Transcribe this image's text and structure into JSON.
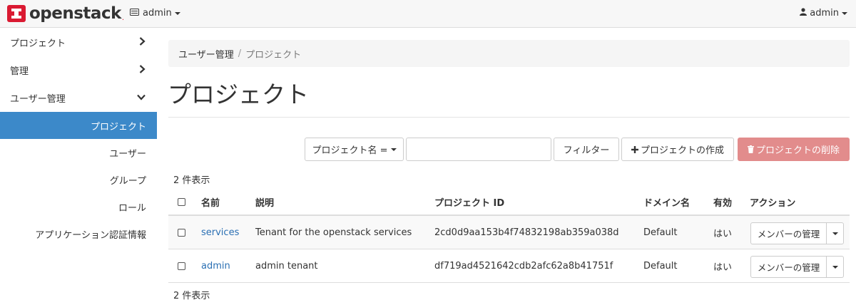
{
  "navbar": {
    "brand": "openstack",
    "brand_mark": ".",
    "project_switcher": "admin",
    "user_menu": "admin"
  },
  "sidebar": {
    "groups": [
      {
        "label": "プロジェクト",
        "icon": "chevron-right-icon"
      },
      {
        "label": "管理",
        "icon": "chevron-right-icon"
      },
      {
        "label": "ユーザー管理",
        "icon": "chevron-down-icon"
      }
    ],
    "sub_items": [
      {
        "label": "プロジェクト",
        "active": true
      },
      {
        "label": "ユーザー"
      },
      {
        "label": "グループ"
      },
      {
        "label": "ロール"
      },
      {
        "label": "アプリケーション認証情報"
      }
    ]
  },
  "breadcrumb": {
    "parent": "ユーザー管理",
    "separator": "/",
    "current": "プロジェクト"
  },
  "page_title": "プロジェクト",
  "toolbar": {
    "filter_field_label": "プロジェクト名 =",
    "filter_input_value": "",
    "filter_button": "フィルター",
    "create_button": "プロジェクトの作成",
    "delete_button": "プロジェクトの削除"
  },
  "count_text": "2 件表示",
  "table": {
    "columns": [
      "名前",
      "説明",
      "プロジェクト ID",
      "ドメイン名",
      "有効",
      "アクション"
    ],
    "rows": [
      {
        "name": "services",
        "description": "Tenant for the openstack services",
        "project_id": "2cd0d9aa153b4f74832198ab359a038d",
        "domain": "Default",
        "enabled": "はい",
        "action": "メンバーの管理"
      },
      {
        "name": "admin",
        "description": "admin tenant",
        "project_id": "df719ad4521642cdb2afc62a8b41751f",
        "domain": "Default",
        "enabled": "はい",
        "action": "メンバーの管理"
      }
    ]
  },
  "colors": {
    "accent": "#3c89c9",
    "danger": "#e28c8c",
    "brand_red": "#da1a32",
    "link": "#2a6fb3"
  }
}
